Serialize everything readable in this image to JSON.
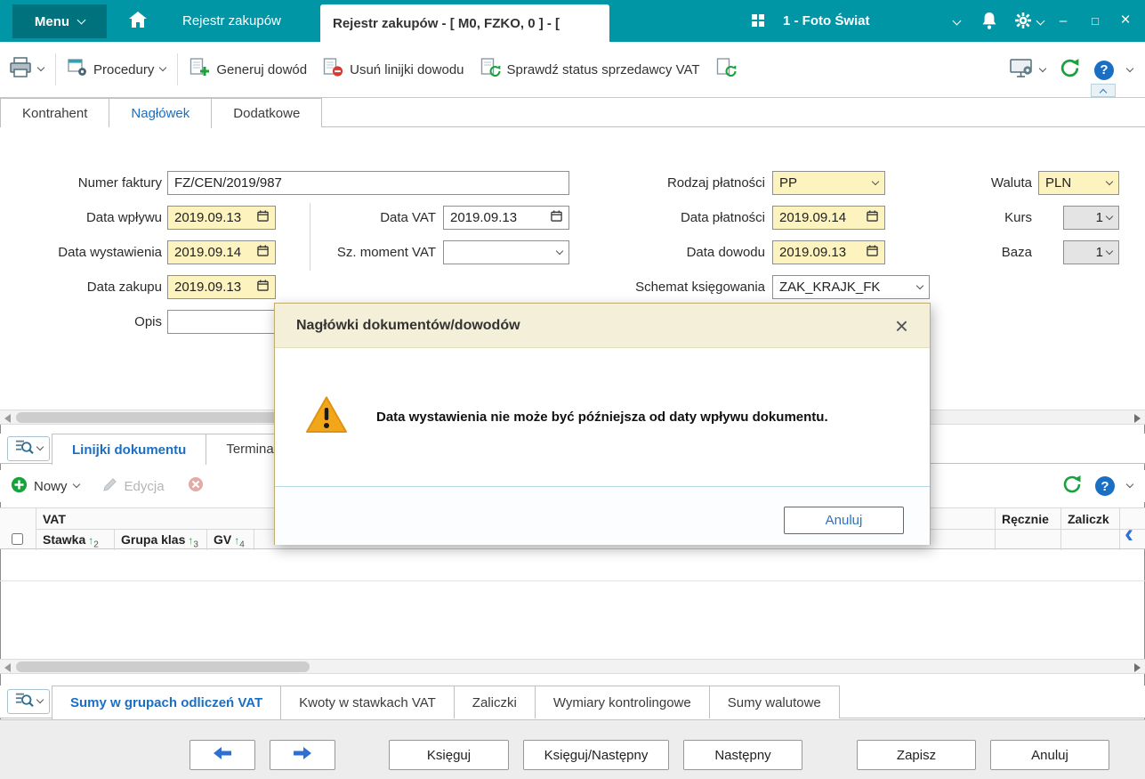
{
  "colors": {
    "topbar_teal": "#0096a6",
    "accent_blue": "#1a6fc4",
    "highlight_yellow": "#fdf3bf",
    "warning_orange": "#f2a71b",
    "dialog_border_tan": "#bfae6e",
    "success_green": "#18a23c",
    "danger_red": "#d73a30"
  },
  "icons": {
    "sort_asc": "↑",
    "minimize": "–",
    "maximize": "□",
    "close": "×",
    "help": "?",
    "dialog_close": "×",
    "collapse_left": "‹"
  },
  "titlebar": {
    "menu": "Menu",
    "nav_tab": "Rejestr zakupów",
    "active_tab": "Rejestr zakupów - [ M0, FZKO, 0 ] - [",
    "company": "1 - Foto Świat"
  },
  "toolbar": {
    "procedury": "Procedury",
    "generuj_dowod": "Generuj dowód",
    "usun_linijki": "Usuń linijki dowodu",
    "sprawdz_status": "Sprawdź status sprzedawcy VAT"
  },
  "header_tabs": {
    "kontrahent": "Kontrahent",
    "naglowek": "Nagłówek",
    "dodatkowe": "Dodatkowe"
  },
  "form": {
    "numer_faktury_label": "Numer faktury",
    "numer_faktury_value": "FZ/CEN/2019/987",
    "data_wplywu_label": "Data wpływu",
    "data_wplywu_value": "2019.09.13",
    "data_wystawienia_label": "Data wystawienia",
    "data_wystawienia_value": "2019.09.14",
    "data_zakupu_label": "Data zakupu",
    "data_zakupu_value": "2019.09.13",
    "opis_label": "Opis",
    "opis_value": "",
    "data_vat_label": "Data VAT",
    "data_vat_value": "2019.09.13",
    "sz_moment_vat_label": "Sz. moment VAT",
    "sz_moment_vat_value": "",
    "rodzaj_platnosci_label": "Rodzaj płatności",
    "rodzaj_platnosci_value": "PP",
    "data_platnosci_label": "Data płatności",
    "data_platnosci_value": "2019.09.14",
    "data_dowodu_label": "Data dowodu",
    "data_dowodu_value": "2019.09.13",
    "schemat_label": "Schemat księgowania",
    "schemat_value": "ZAK_KRAJK_FK",
    "waluta_label": "Waluta",
    "waluta_value": "PLN",
    "kurs_label": "Kurs",
    "kurs_value": "1",
    "baza_label": "Baza",
    "baza_value": "1"
  },
  "dialog": {
    "title": "Nagłówki dokumentów/dowodów",
    "message": "Data wystawienia nie może być późniejsza od daty wpływu dokumentu.",
    "cancel_button": "Anuluj"
  },
  "lines_pane": {
    "tab_linijki": "Linijki dokumentu",
    "tab_terminarz": "Terminar",
    "nowy": "Nowy",
    "edycja": "Edycja",
    "table": {
      "group": "VAT",
      "columns": [
        {
          "label": "Stawka",
          "sort": "2"
        },
        {
          "label": "Grupa klas",
          "sort": "3"
        },
        {
          "label": "GV",
          "sort": "4"
        }
      ],
      "col_recznie": "Ręcznie",
      "col_zaliczki": "Zaliczk"
    }
  },
  "sums_pane": {
    "tabs": [
      "Sumy w grupach odliczeń VAT",
      "Kwoty w stawkach VAT",
      "Zaliczki",
      "Wymiary kontrolingowe",
      "Sumy walutowe"
    ]
  },
  "footer": {
    "ksieguj": "Księguj",
    "ksieguj_nastepny": "Księguj/Następny",
    "nastepny": "Następny",
    "zapisz": "Zapisz",
    "anuluj": "Anuluj"
  }
}
